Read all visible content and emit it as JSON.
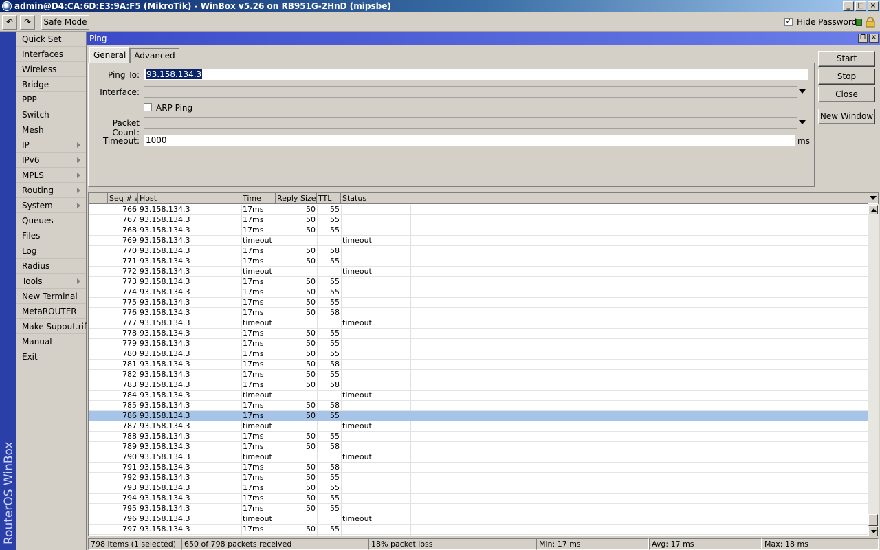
{
  "window": {
    "title": "admin@D4:CA:6D:E3:9A:F5 (MikroTik) - WinBox v5.26 on RB951G-2HnD (mipsbe)",
    "controls": [
      "_",
      "□",
      "×"
    ]
  },
  "toolbar": {
    "undo_label": "↶",
    "redo_label": "↷",
    "safe_mode_label": "Safe Mode",
    "hide_passwords_label": "Hide Passwords",
    "hide_passwords_checked": "✓"
  },
  "brand": {
    "text": "RouterOS WinBox"
  },
  "menu": {
    "items": [
      {
        "label": "Quick Set",
        "submenu": false
      },
      {
        "label": "Interfaces",
        "submenu": false
      },
      {
        "label": "Wireless",
        "submenu": false
      },
      {
        "label": "Bridge",
        "submenu": false
      },
      {
        "label": "PPP",
        "submenu": false
      },
      {
        "label": "Switch",
        "submenu": false
      },
      {
        "label": "Mesh",
        "submenu": false
      },
      {
        "label": "IP",
        "submenu": true
      },
      {
        "label": "IPv6",
        "submenu": true
      },
      {
        "label": "MPLS",
        "submenu": true
      },
      {
        "label": "Routing",
        "submenu": true
      },
      {
        "label": "System",
        "submenu": true
      },
      {
        "label": "Queues",
        "submenu": false
      },
      {
        "label": "Files",
        "submenu": false
      },
      {
        "label": "Log",
        "submenu": false
      },
      {
        "label": "Radius",
        "submenu": false
      },
      {
        "label": "Tools",
        "submenu": true
      },
      {
        "label": "New Terminal",
        "submenu": false
      },
      {
        "label": "MetaROUTER",
        "submenu": false
      },
      {
        "label": "Make Supout.rif",
        "submenu": false
      },
      {
        "label": "Manual",
        "submenu": false
      },
      {
        "label": "Exit",
        "submenu": false
      }
    ]
  },
  "ping": {
    "title": "Ping",
    "tabs": [
      "General",
      "Advanced"
    ],
    "fields": {
      "ping_to_label": "Ping To:",
      "ping_to_value": "93.158.134.3",
      "interface_label": "Interface:",
      "interface_value": "",
      "arp_ping_label": "ARP Ping",
      "packet_count_label": "Packet Count:",
      "packet_count_value": "",
      "timeout_label": "Timeout:",
      "timeout_value": "1000",
      "timeout_unit": "ms"
    },
    "buttons": {
      "start": "Start",
      "stop": "Stop",
      "close": "Close",
      "new_window": "New Window"
    }
  },
  "table": {
    "columns": [
      "Seq #",
      "Host",
      "Time",
      "Reply Size",
      "TTL",
      "Status"
    ],
    "selected_seq": "786",
    "rows": [
      [
        "766",
        "93.158.134.3",
        "17ms",
        "50",
        "55",
        ""
      ],
      [
        "767",
        "93.158.134.3",
        "17ms",
        "50",
        "55",
        ""
      ],
      [
        "768",
        "93.158.134.3",
        "17ms",
        "50",
        "55",
        ""
      ],
      [
        "769",
        "93.158.134.3",
        "timeout",
        "",
        "",
        "timeout"
      ],
      [
        "770",
        "93.158.134.3",
        "17ms",
        "50",
        "58",
        ""
      ],
      [
        "771",
        "93.158.134.3",
        "17ms",
        "50",
        "55",
        ""
      ],
      [
        "772",
        "93.158.134.3",
        "timeout",
        "",
        "",
        "timeout"
      ],
      [
        "773",
        "93.158.134.3",
        "17ms",
        "50",
        "55",
        ""
      ],
      [
        "774",
        "93.158.134.3",
        "17ms",
        "50",
        "55",
        ""
      ],
      [
        "775",
        "93.158.134.3",
        "17ms",
        "50",
        "55",
        ""
      ],
      [
        "776",
        "93.158.134.3",
        "17ms",
        "50",
        "58",
        ""
      ],
      [
        "777",
        "93.158.134.3",
        "timeout",
        "",
        "",
        "timeout"
      ],
      [
        "778",
        "93.158.134.3",
        "17ms",
        "50",
        "55",
        ""
      ],
      [
        "779",
        "93.158.134.3",
        "17ms",
        "50",
        "55",
        ""
      ],
      [
        "780",
        "93.158.134.3",
        "17ms",
        "50",
        "55",
        ""
      ],
      [
        "781",
        "93.158.134.3",
        "17ms",
        "50",
        "58",
        ""
      ],
      [
        "782",
        "93.158.134.3",
        "17ms",
        "50",
        "55",
        ""
      ],
      [
        "783",
        "93.158.134.3",
        "17ms",
        "50",
        "58",
        ""
      ],
      [
        "784",
        "93.158.134.3",
        "timeout",
        "",
        "",
        "timeout"
      ],
      [
        "785",
        "93.158.134.3",
        "17ms",
        "50",
        "58",
        ""
      ],
      [
        "786",
        "93.158.134.3",
        "17ms",
        "50",
        "55",
        ""
      ],
      [
        "787",
        "93.158.134.3",
        "timeout",
        "",
        "",
        "timeout"
      ],
      [
        "788",
        "93.158.134.3",
        "17ms",
        "50",
        "55",
        ""
      ],
      [
        "789",
        "93.158.134.3",
        "17ms",
        "50",
        "58",
        ""
      ],
      [
        "790",
        "93.158.134.3",
        "timeout",
        "",
        "",
        "timeout"
      ],
      [
        "791",
        "93.158.134.3",
        "17ms",
        "50",
        "58",
        ""
      ],
      [
        "792",
        "93.158.134.3",
        "17ms",
        "50",
        "55",
        ""
      ],
      [
        "793",
        "93.158.134.3",
        "17ms",
        "50",
        "55",
        ""
      ],
      [
        "794",
        "93.158.134.3",
        "17ms",
        "50",
        "55",
        ""
      ],
      [
        "795",
        "93.158.134.3",
        "17ms",
        "50",
        "55",
        ""
      ],
      [
        "796",
        "93.158.134.3",
        "timeout",
        "",
        "",
        "timeout"
      ],
      [
        "797",
        "93.158.134.3",
        "17ms",
        "50",
        "55",
        ""
      ]
    ]
  },
  "status": {
    "items": "798 items (1 selected)",
    "received": "650 of 798 packets received",
    "loss": "18% packet loss",
    "min": "Min: 17 ms",
    "avg": "Avg: 17 ms",
    "max": "Max: 18 ms"
  },
  "colors": {
    "brand_strip": "#2b3fa8",
    "selection": "#a6c4e8",
    "window_header": "#3b4bc8"
  }
}
